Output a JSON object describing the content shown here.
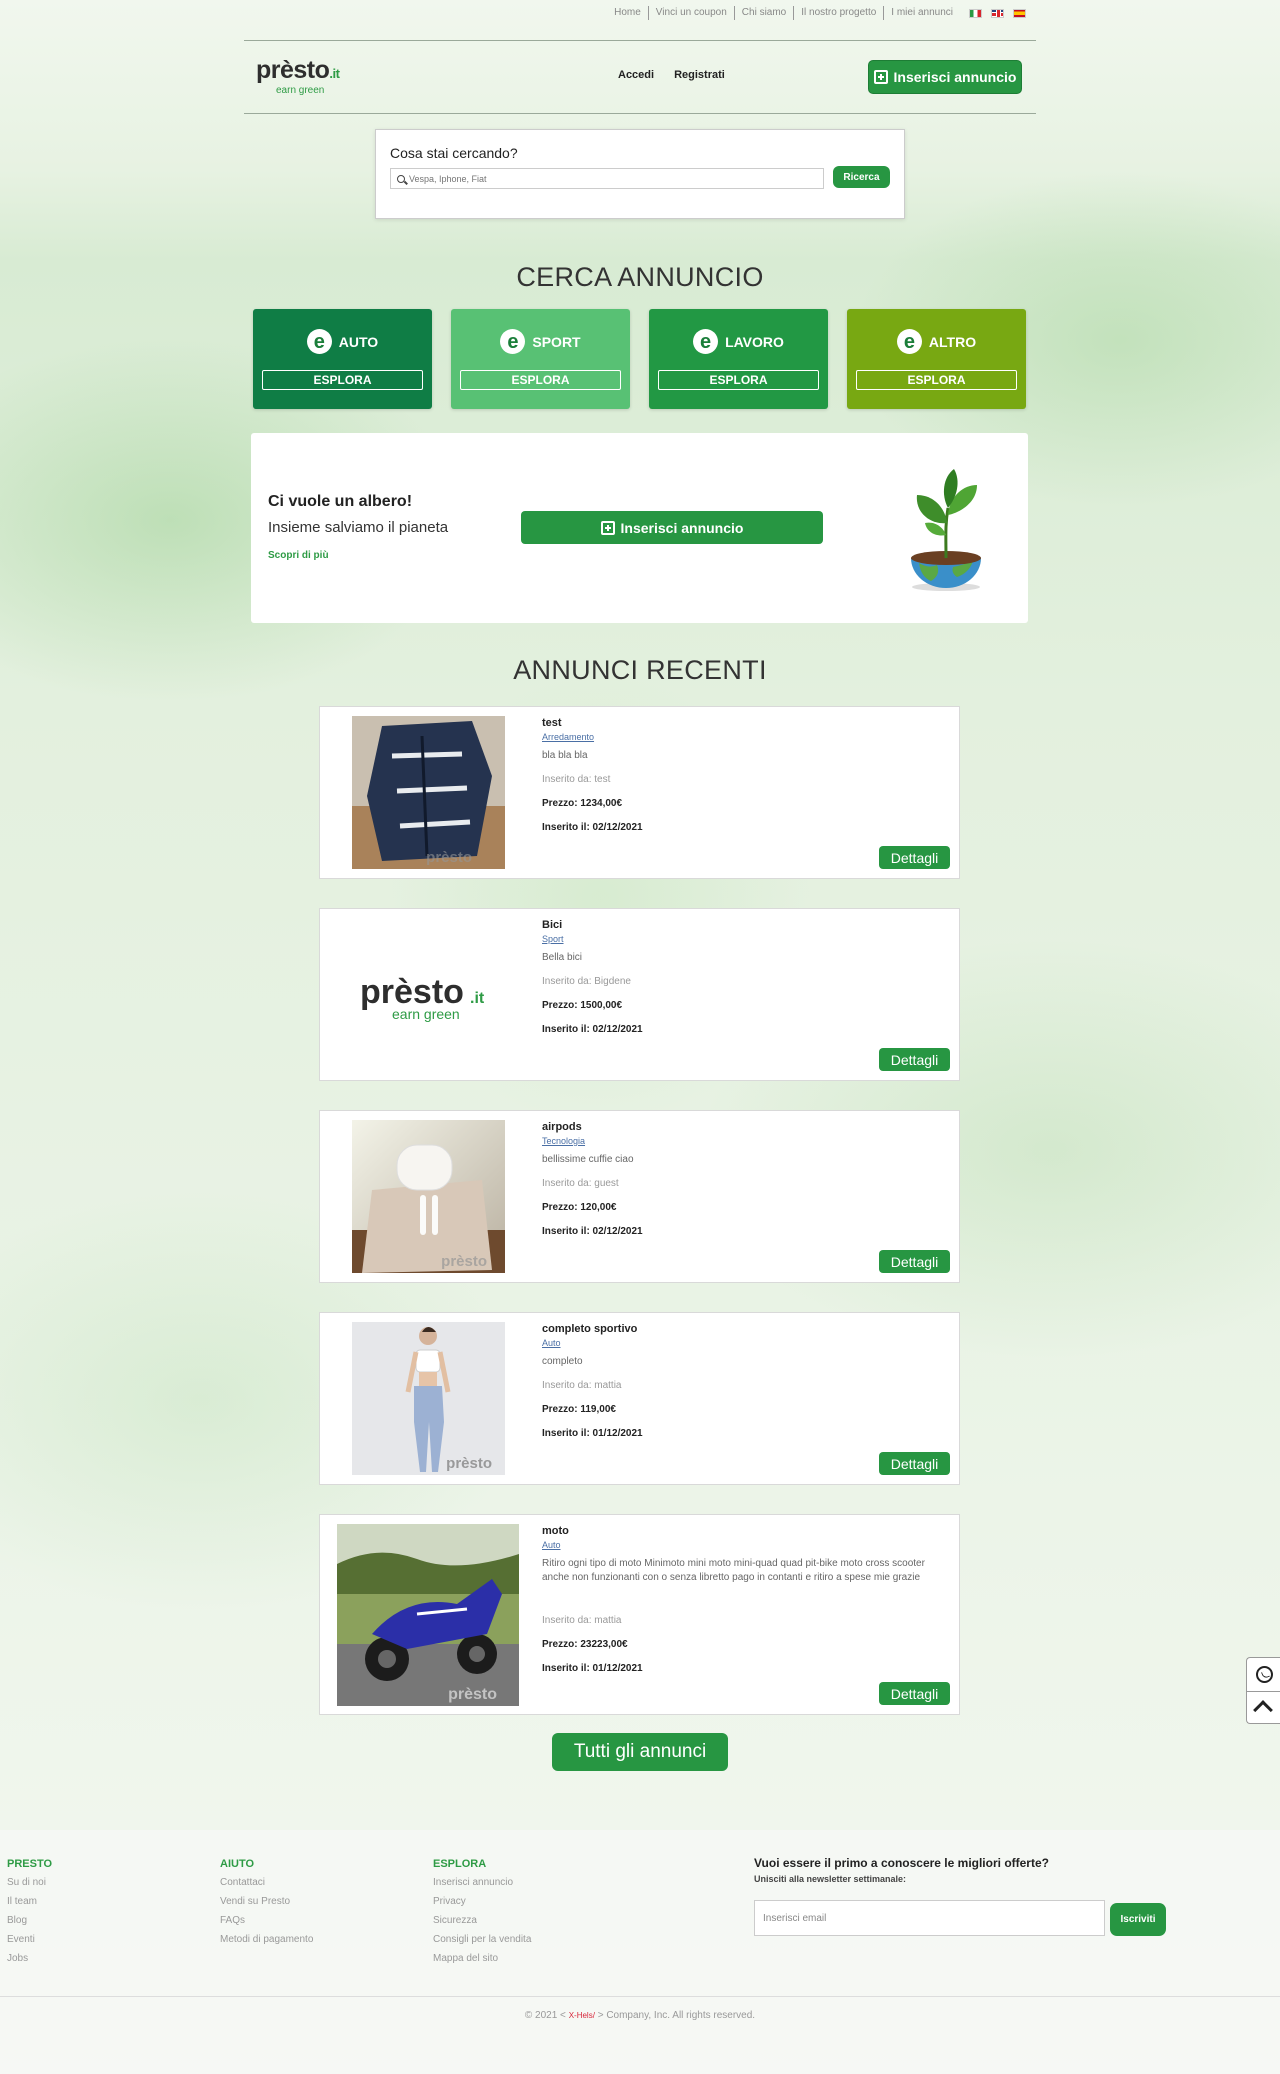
{
  "topnav": {
    "links": [
      "Home",
      "Vinci un coupon",
      "Chi siamo",
      "Il nostro progetto",
      "I miei annunci"
    ],
    "flags": [
      "it",
      "gb",
      "es"
    ]
  },
  "header": {
    "logo_word": "prèsto",
    "logo_tld": ".it",
    "logo_tagline": "earn green",
    "login": "Accedi",
    "register": "Registrati",
    "insert_button": "Inserisci annuncio"
  },
  "search": {
    "title": "Cosa stai cercando?",
    "placeholder": "Vespa, Iphone, Fiat",
    "button": "Ricerca"
  },
  "categories": {
    "title": "CERCA ANNUNCIO",
    "items": [
      {
        "label": "AUTO",
        "button": "ESPLORA",
        "color": "#0f7d45"
      },
      {
        "label": "SPORT",
        "button": "ESPLORA",
        "color": "#58c174"
      },
      {
        "label": "LAVORO",
        "button": "ESPLORA",
        "color": "#229844"
      },
      {
        "label": "ALTRO",
        "button": "ESPLORA",
        "color": "#78a812"
      }
    ]
  },
  "banner": {
    "heading": "Ci vuole un albero!",
    "subheading": "Insieme salviamo il pianeta",
    "link": "Scopri di più",
    "button": "Inserisci annuncio"
  },
  "recent": {
    "title": "ANNUNCI RECENTI",
    "ads": [
      {
        "title": "test",
        "category": "Arredamento",
        "description": "bla bla bla",
        "author": "Inserito da: test",
        "price": "Prezzo: 1234,00€",
        "date": "Inserito il: 02/12/2021",
        "button": "Dettagli",
        "image": "jacket"
      },
      {
        "title": "Bici",
        "category": "Sport",
        "description": "Bella bici",
        "author": "Inserito da: Bigdene",
        "price": "Prezzo: 1500,00€",
        "date": "Inserito il: 02/12/2021",
        "button": "Dettagli",
        "image": "logo"
      },
      {
        "title": "airpods",
        "category": "Tecnologia",
        "description": "bellissime cuffie ciao",
        "author": "Inserito da: guest",
        "price": "Prezzo: 120,00€",
        "date": "Inserito il: 02/12/2021",
        "button": "Dettagli",
        "image": "airpods"
      },
      {
        "title": "completo sportivo",
        "category": "Auto",
        "description": "completo",
        "author": "Inserito da: mattia",
        "price": "Prezzo: 119,00€",
        "date": "Inserito il: 01/12/2021",
        "button": "Dettagli",
        "image": "sportswear"
      },
      {
        "title": "moto",
        "category": "Auto",
        "description": "Ritiro ogni tipo di moto Minimoto mini moto mini-quad quad pit-bike moto cross scooter anche non funzionanti con o senza libretto pago in contanti e ritiro a spese mie grazie",
        "author": "Inserito da: mattia",
        "price": "Prezzo: 23223,00€",
        "date": "Inserito il: 01/12/2021",
        "button": "Dettagli",
        "image": "motorbike"
      }
    ],
    "all_button": "Tutti gli annunci"
  },
  "footer": {
    "cols": [
      {
        "heading": "PRESTO",
        "links": [
          "Su di noi",
          "Il team",
          "Blog",
          "Eventi",
          "Jobs"
        ]
      },
      {
        "heading": "AIUTO",
        "links": [
          "Contattaci",
          "Vendi su Presto",
          "FAQs",
          "Metodi di pagamento"
        ]
      },
      {
        "heading": "ESPLORA",
        "links": [
          "Inserisci annuncio",
          "Privacy",
          "Sicurezza",
          "Consigli per la vendita",
          "Mappa del sito"
        ]
      }
    ],
    "newsletter": {
      "heading": "Vuoi essere il primo a conoscere le migliori offerte?",
      "sub": "Unisciti alla newsletter settimanale:",
      "placeholder": "Inserisci email",
      "button": "Iscriviti"
    },
    "copyright_pre": "© 2021 <",
    "copyright_brand": "X-Hels/",
    "copyright_post": "> Company, Inc. All rights reserved."
  },
  "widgets": [
    "whatsapp-icon",
    "back-to-top-icon"
  ]
}
